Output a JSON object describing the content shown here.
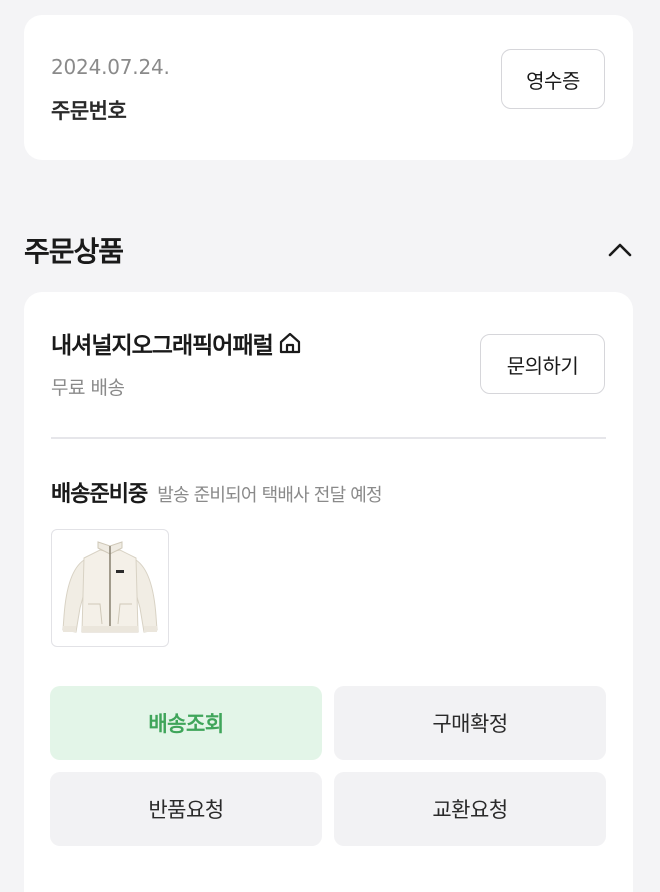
{
  "order": {
    "date": "2024.07.24.",
    "number_label": "주문번호",
    "receipt_label": "영수증"
  },
  "section": {
    "title": "주문상품",
    "toggle_icon": "chevron-up-icon"
  },
  "seller": {
    "name": "내셔널지오그래픽어패럴",
    "store_icon": "home-icon",
    "shipping_fee": "무료 배송",
    "inquiry_label": "문의하기"
  },
  "status": {
    "title": "배송준비중",
    "description": "발송 준비되어 택배사 전달 예정"
  },
  "product": {
    "image": "fleece-jacket-image"
  },
  "actions": {
    "track_label": "배송조회",
    "confirm_label": "구매확정",
    "return_label": "반품요청",
    "exchange_label": "교환요청"
  },
  "colors": {
    "accent_green": "#3fa55a",
    "accent_green_bg": "#e3f5e8",
    "background": "#f4f4f6",
    "muted_text": "#8a8a8a"
  }
}
